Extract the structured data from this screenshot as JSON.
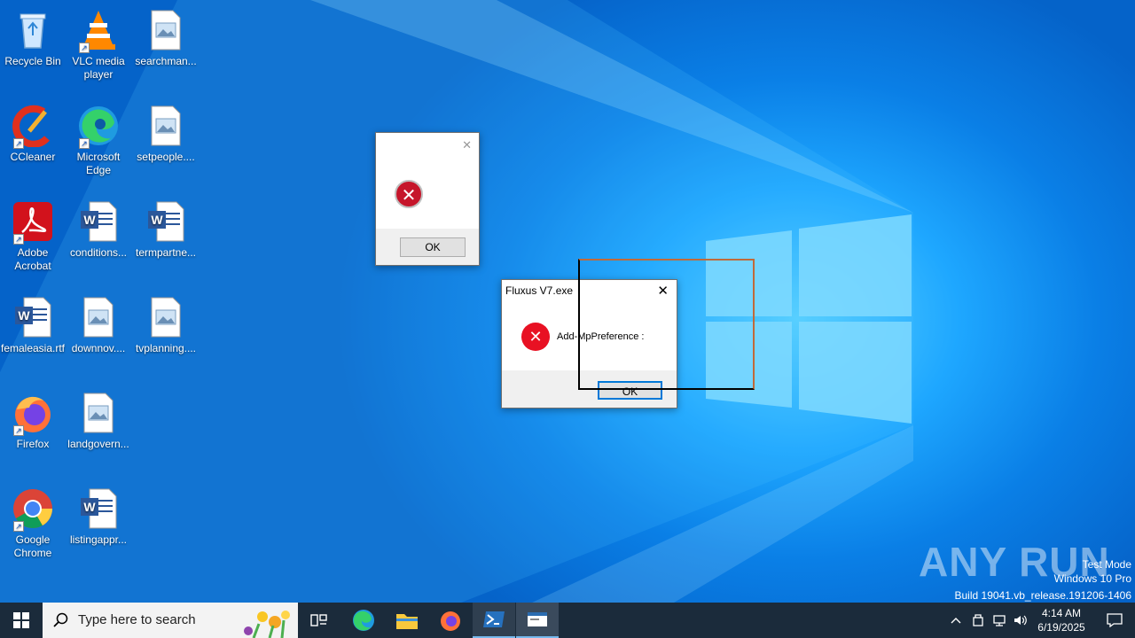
{
  "desktop": {
    "icons": [
      {
        "label": "Recycle Bin"
      },
      {
        "label": "VLC media player"
      },
      {
        "label": "searchman..."
      },
      {
        "label": "CCleaner"
      },
      {
        "label": "Microsoft Edge"
      },
      {
        "label": "setpeople...."
      },
      {
        "label": "Adobe Acrobat"
      },
      {
        "label": "conditions..."
      },
      {
        "label": "termpartne..."
      },
      {
        "label": "femaleasia.rtf"
      },
      {
        "label": "downnov...."
      },
      {
        "label": "tvplanning...."
      },
      {
        "label": "Firefox"
      },
      {
        "label": "landgovern..."
      },
      {
        "label": "Google Chrome"
      },
      {
        "label": "listingappr..."
      }
    ]
  },
  "dialog1": {
    "ok_label": "OK",
    "close_glyph": "✕"
  },
  "dialog2": {
    "title": "Fluxus V7.exe",
    "message": "Add-MpPreference :",
    "ok_label": "OK",
    "close_glyph": "✕"
  },
  "watermark": {
    "brand": "ANY RUN",
    "line1": "Test Mode",
    "line2": "Windows 10 Pro",
    "line3": "Build 19041.vb_release.191206-1406"
  },
  "taskbar": {
    "search_placeholder": "Type here to search",
    "time": "4:14 AM",
    "date": "6/19/2025"
  },
  "colors": {
    "accent": "#0078d7",
    "error": "#e81123",
    "taskbar": "#1b2b3b"
  }
}
